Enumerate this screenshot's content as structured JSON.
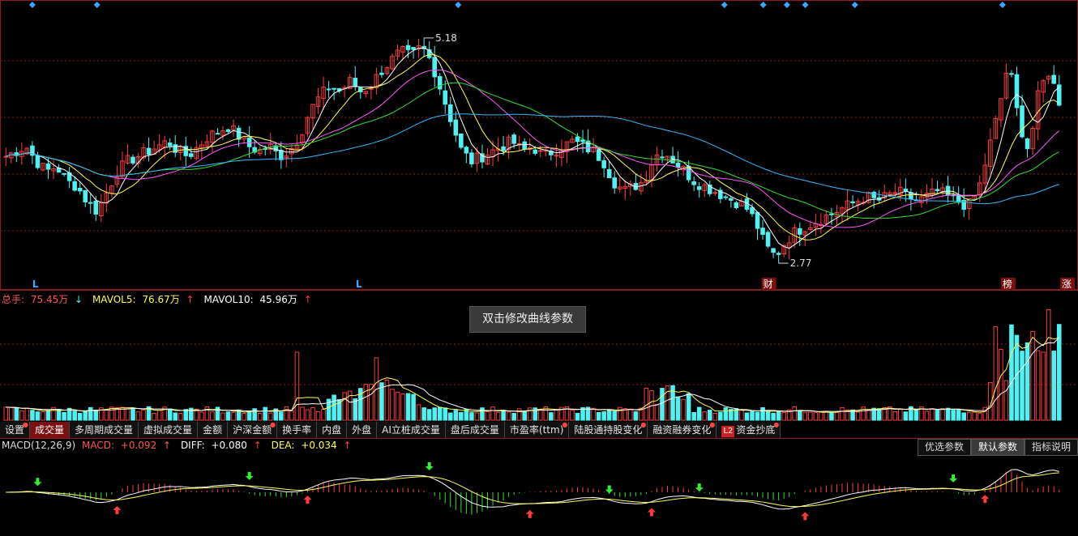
{
  "colors": {
    "up": "#ff3b3b",
    "down": "#4ef2f2",
    "ma5": "#ffffff",
    "ma10": "#ffff55",
    "ma20": "#ff55ff",
    "ma30": "#33dd33",
    "ma60": "#33bbff",
    "grid": "#8a1e1e"
  },
  "price_chart": {
    "high_label": "5.18",
    "low_label": "2.77",
    "markers": [
      {
        "text": "L",
        "pos": 0.03
      },
      {
        "text": "L",
        "pos": 0.33
      }
    ],
    "event_tags": [
      {
        "text": "财",
        "pos": 0.708
      },
      {
        "text": "榜",
        "pos": 0.93
      },
      {
        "text": "涨",
        "pos": 0.985
      }
    ]
  },
  "volume_legend": {
    "total_label": "总手: ",
    "total_value": "75.45万",
    "ma5_label": "MAVOL5: ",
    "ma5_value": "76.67万",
    "ma10_label": "MAVOL10: ",
    "ma10_value": "45.96万"
  },
  "tooltip": "双击修改曲线参数",
  "tabs": [
    {
      "label": "设置",
      "dot": true
    },
    {
      "label": "成交量",
      "active": true
    },
    {
      "label": "多周期成交量"
    },
    {
      "label": "虚拟成交量"
    },
    {
      "label": "金额"
    },
    {
      "label": "沪深金额",
      "dot": true
    },
    {
      "label": "换手率"
    },
    {
      "label": "内盘"
    },
    {
      "label": "外盘"
    },
    {
      "label": "AI立桩成交量"
    },
    {
      "label": "盘后成交量"
    },
    {
      "label": "市盈率(ttm)",
      "dot": true
    },
    {
      "label": "陆股通持股变化",
      "dot": true
    },
    {
      "label": "融资融券变化",
      "dot": true
    },
    {
      "label": "资金抄底",
      "badge": "L2",
      "dot": true
    }
  ],
  "macd_legend": {
    "name": "MACD(12,26,9)",
    "macd_label": "MACD: ",
    "macd_value": "+0.092",
    "diff_label": "DIFF: ",
    "diff_value": "+0.080",
    "dea_label": "DEA: ",
    "dea_value": "+0.034"
  },
  "macd_buttons": [
    {
      "label": "优选参数"
    },
    {
      "label": "默认参数",
      "active": true
    },
    {
      "label": "指标说明"
    }
  ],
  "chart_data": {
    "type": "candlestick",
    "close_path": [
      3.85,
      3.9,
      3.95,
      3.8,
      3.7,
      3.75,
      3.6,
      3.55,
      3.4,
      3.3,
      3.5,
      3.7,
      3.8,
      3.85,
      3.9,
      3.95,
      4.0,
      3.9,
      3.85,
      3.95,
      4.05,
      4.1,
      4.15,
      4.05,
      3.95,
      3.9,
      3.95,
      3.85,
      3.9,
      4.05,
      4.3,
      4.45,
      4.55,
      4.5,
      4.6,
      4.5,
      4.55,
      4.7,
      4.8,
      4.9,
      4.85,
      4.95,
      4.8,
      4.5,
      4.2,
      3.9,
      3.8,
      3.85,
      3.9,
      3.95,
      4.0,
      3.9,
      3.95,
      3.85,
      3.9,
      3.95,
      4.0,
      3.95,
      3.9,
      3.8,
      3.6,
      3.5,
      3.55,
      3.6,
      3.85,
      3.9,
      3.8,
      3.7,
      3.6,
      3.55,
      3.5,
      3.45,
      3.4,
      3.35,
      3.2,
      2.95,
      2.85,
      3.0,
      3.1,
      3.15,
      3.2,
      3.25,
      3.3,
      3.35,
      3.4,
      3.45,
      3.4,
      3.45,
      3.5,
      3.45,
      3.4,
      3.45,
      3.5,
      3.45,
      3.4,
      3.35,
      3.5,
      3.9,
      4.3,
      4.8,
      4.2,
      3.9,
      4.5,
      4.7,
      4.4
    ]
  }
}
